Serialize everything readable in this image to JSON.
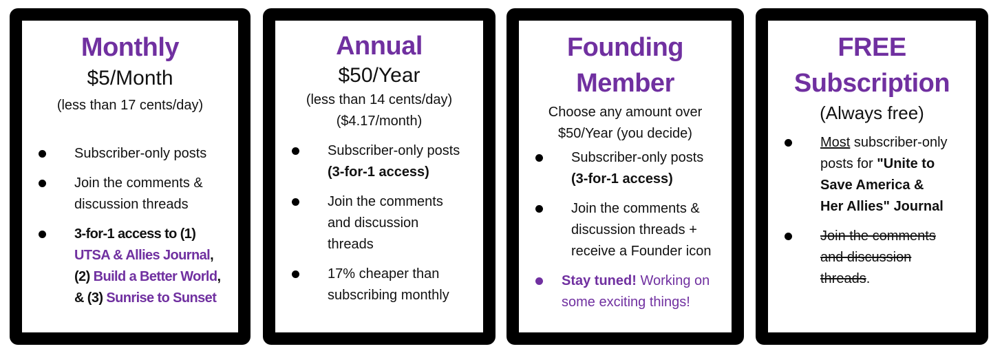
{
  "colors": {
    "accent": "#7030A0",
    "frame": "#000000",
    "text": "#111111"
  },
  "plans": [
    {
      "title": "Monthly",
      "price": "$5/Month",
      "subtitle": "(less than 17 cents/day)",
      "features": [
        {
          "text": "Subscriber-only posts"
        },
        {
          "text": "Join the comments & discussion threads"
        },
        {
          "intro": "3-for-1 access to (1)",
          "pub1": "UTSA & Allies Journal",
          "sep1": ",",
          "num2": "(2)",
          "pub2": "Build a Better World",
          "sep2": ",",
          "num3": "& (3)",
          "pub3": "Sunrise to Sunset"
        }
      ]
    },
    {
      "title": "Annual",
      "price": "$50/Year",
      "subtitle": "(less than 14 cents/day)",
      "subtitle2": "($4.17/month)",
      "features": [
        {
          "text": "Subscriber-only posts",
          "bold_suffix": "(3-for-1 access)"
        },
        {
          "text": "Join the comments and discussion threads"
        },
        {
          "text": "17% cheaper than subscribing monthly"
        }
      ]
    },
    {
      "title_line1": "Founding",
      "title_line2": "Member",
      "subtitle": "Choose any amount over $50/Year (you decide)",
      "features": [
        {
          "text": "Subscriber-only posts",
          "bold_suffix": "(3-for-1 access)"
        },
        {
          "text": "Join the comments & discussion threads + receive a Founder icon"
        },
        {
          "bold_prefix": "Stay tuned!",
          "text": "Working on some exciting things!",
          "accent": true
        }
      ]
    },
    {
      "title_line1": "FREE",
      "title_line2": "Subscription",
      "subtitle": "(Always free)",
      "features": [
        {
          "underlined_prefix": "Most",
          "text": "subscriber-only posts for",
          "bold_suffix": "\"Unite to Save America & Her Allies\" Journal"
        },
        {
          "struck_text": "Join the comments and discussion threads",
          "suffix": "."
        }
      ]
    }
  ]
}
